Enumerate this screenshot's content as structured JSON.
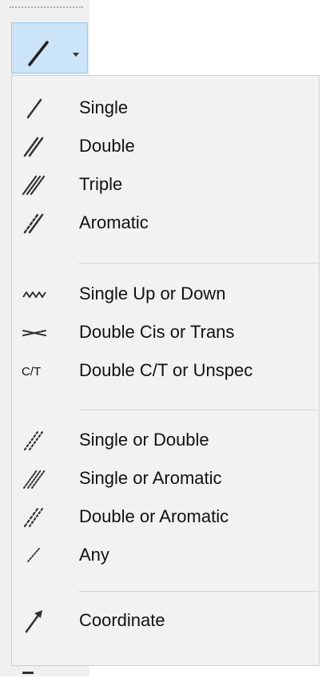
{
  "toolbar": {
    "bond_button_icon": "single-bond-icon",
    "dropdown_icon": "chevron-down-icon",
    "bottom_tool_icon": "minus-icon"
  },
  "menu": {
    "items": [
      {
        "label": "Single",
        "icon": "single-bond-icon"
      },
      {
        "label": "Double",
        "icon": "double-bond-icon"
      },
      {
        "label": "Triple",
        "icon": "triple-bond-icon"
      },
      {
        "label": "Aromatic",
        "icon": "aromatic-bond-icon"
      },
      {
        "label": "Single Up or Down",
        "icon": "wavy-bond-icon"
      },
      {
        "label": "Double Cis or Trans",
        "icon": "crossed-double-bond-icon"
      },
      {
        "label": "Double C/T or Unspec",
        "icon": "ct-text-icon",
        "icon_text": "C/T"
      },
      {
        "label": "Single or Double",
        "icon": "single-or-double-bond-icon"
      },
      {
        "label": "Single or Aromatic",
        "icon": "single-or-aromatic-bond-icon"
      },
      {
        "label": "Double or Aromatic",
        "icon": "double-or-aromatic-bond-icon"
      },
      {
        "label": "Any",
        "icon": "any-bond-icon"
      },
      {
        "label": "Coordinate",
        "icon": "coordinate-bond-icon"
      }
    ]
  },
  "colors": {
    "selected_button_bg": "#cce4f7",
    "selected_button_border": "#99c9ef",
    "menu_bg": "#f2f2f2",
    "icon": "#333333"
  }
}
